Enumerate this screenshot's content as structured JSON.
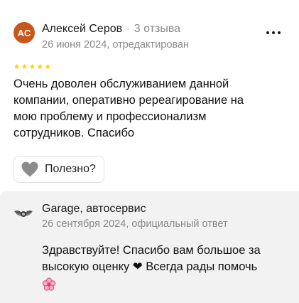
{
  "review": {
    "avatar_initials": "АС",
    "avatar_color": "#c9561b",
    "author_name": "Алексей Серов",
    "author_separator": "·",
    "review_count": "3 отзыва",
    "date": "26 июня 2024, отредактирован",
    "rating": 5,
    "star_color": "#ffcc00",
    "text": "Очень доволен обслуживанием данной компании, оперативно ререагирование на мою проблему и профессионализм сотрудников. Спасибо",
    "helpful_label": "Полезно?",
    "more_icon": "more-horizontal-icon",
    "helpful_icon": "heart-icon"
  },
  "reply": {
    "org_name": "Garage, автосервис",
    "date": "26 сентября 2024, официальный ответ",
    "text_part1": "Здравствуйте! Спасибо вам большое за высокую оценку",
    "heart": "❤",
    "text_part2": "Всегда рады помочь",
    "flower_icon": "cherry-blossom-icon",
    "logo_icon": "garage-winged-logo"
  }
}
